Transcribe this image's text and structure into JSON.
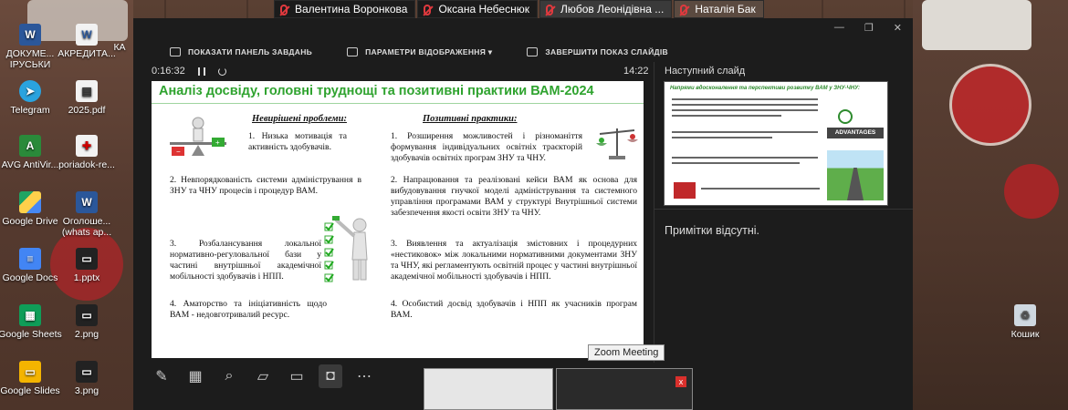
{
  "participants": [
    {
      "name": "Валентина Воронкова"
    },
    {
      "name": "Оксана Небеснюк"
    },
    {
      "name": "Любов Леонідівна ..."
    },
    {
      "name": "Наталія Бак"
    }
  ],
  "desktop_icons": [
    {
      "label": "ДОКУМЕ... ІРУСЬКИ",
      "icon": "word-doc-icon"
    },
    {
      "label": "АКРЕДИТА...",
      "icon": "word-doc-icon"
    },
    {
      "label": "Telegram",
      "icon": "telegram-icon"
    },
    {
      "label": "2025.pdf",
      "icon": "pdf-icon"
    },
    {
      "label": "AVG AntiVir...",
      "icon": "avg-icon"
    },
    {
      "label": "poriadok-re...",
      "icon": "pdf-icon"
    },
    {
      "label": "Google Drive",
      "icon": "google-drive-icon"
    },
    {
      "label": "Оголоше... (whats ap...",
      "icon": "word-doc-icon"
    },
    {
      "label": "Google Docs",
      "icon": "google-docs-icon"
    },
    {
      "label": "1.pptx",
      "icon": "pptx-icon"
    },
    {
      "label": "Google Sheets",
      "icon": "google-sheets-icon"
    },
    {
      "label": "2.png",
      "icon": "png-icon"
    },
    {
      "label": "Google Slides",
      "icon": "google-slides-icon"
    },
    {
      "label": "3.png",
      "icon": "png-icon"
    },
    {
      "label": "Кошик",
      "icon": "recycle-bin-icon"
    },
    {
      "label": "КА",
      "icon": "file-icon"
    }
  ],
  "toolbar": {
    "show_taskbar": "ПОКАЗАТИ ПАНЕЛЬ ЗАВДАНЬ",
    "display_settings": "ПАРАМЕТРИ ВІДОБРАЖЕННЯ ▾",
    "end_show": "ЗАВЕРШИТИ ПОКАЗ СЛАЙДІВ"
  },
  "timer": {
    "elapsed": "0:16:32",
    "clock": "14:22"
  },
  "slide": {
    "title": "Аналіз досвіду, головні труднощі та позитивні практики ВАМ-2024",
    "left_heading": "Невирішені проблеми:",
    "right_heading": "Позитивні практики:",
    "left_items": [
      "1. Низька мотивація та активність здобувачів.",
      "2. Невпорядкованість системи адміністрування в ЗНУ та ЧНУ процесів і процедур ВАМ.",
      "3. Розбалансування локальної нормативно-регуловальної бази у частині внутрішньої академічної мобільності здобувачів і НПП.",
      "4. Аматорство та ініціативність щодо ВАМ - недовготривалий ресурс."
    ],
    "right_items": [
      "1. Розширення можливостей і різноманіття формування індивідуальних освітніх траєкторій здобувачів освітніх програм ЗНУ та ЧНУ.",
      "2. Напрацювання та реалізовані кейси ВАМ як основа для вибудовування гнучкої моделі адміністрування та системного управління програмами ВАМ у структурі Внутрішньої системи забезпечення якості освіти ЗНУ та ЧНУ.",
      "3. Виявлення та актуалізація змістовних і процедурних «нестиковок» між локальними нормативними документами ЗНУ та ЧНУ, які регламентують освітній процес у частині внутрішньої академічної мобільності здобувачів і НПП.",
      "4. Особистий досвід здобувачів і НПП як учасників програм ВАМ."
    ]
  },
  "next_slide": {
    "label": "Наступний слайд",
    "title": "Напрями вдосконалення та перспективи розвитку ВАМ у ЗНУ-ЧНУ:",
    "badge": "ADVANTAGES"
  },
  "notes": {
    "text": "Примітки відсутні."
  },
  "tooltip": {
    "text": "Zoom Meeting"
  },
  "preview": {
    "close": "x"
  },
  "colors": {
    "slide_title": "#2fa32f",
    "zoom_bg": "#1c1c1c",
    "mic_muted": "#e0393e"
  }
}
